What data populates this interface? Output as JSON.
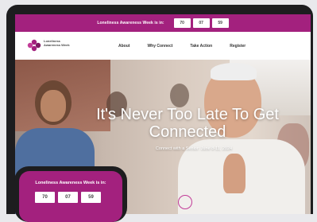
{
  "topbar": {
    "text": "Loneliness Awareness Week is in:",
    "countdown": [
      "70",
      "07",
      "59"
    ],
    "color": "#a3217e"
  },
  "logo": {
    "text": "Loneliness Awareness Week",
    "icon": "flower-logo-icon"
  },
  "nav": {
    "items": [
      "About",
      "Why Connect",
      "Take Action",
      "Register"
    ]
  },
  "hero": {
    "title": "It's Never Too Late To Get Connected",
    "subtitle": "Connect with a Senior: June 8-11, 2024",
    "scroll_icon": "circle-icon",
    "accent": "#c23c98"
  },
  "phone": {
    "title": "Loneliness Awareness Week is in:",
    "countdown": [
      "70",
      "07",
      "59"
    ]
  }
}
